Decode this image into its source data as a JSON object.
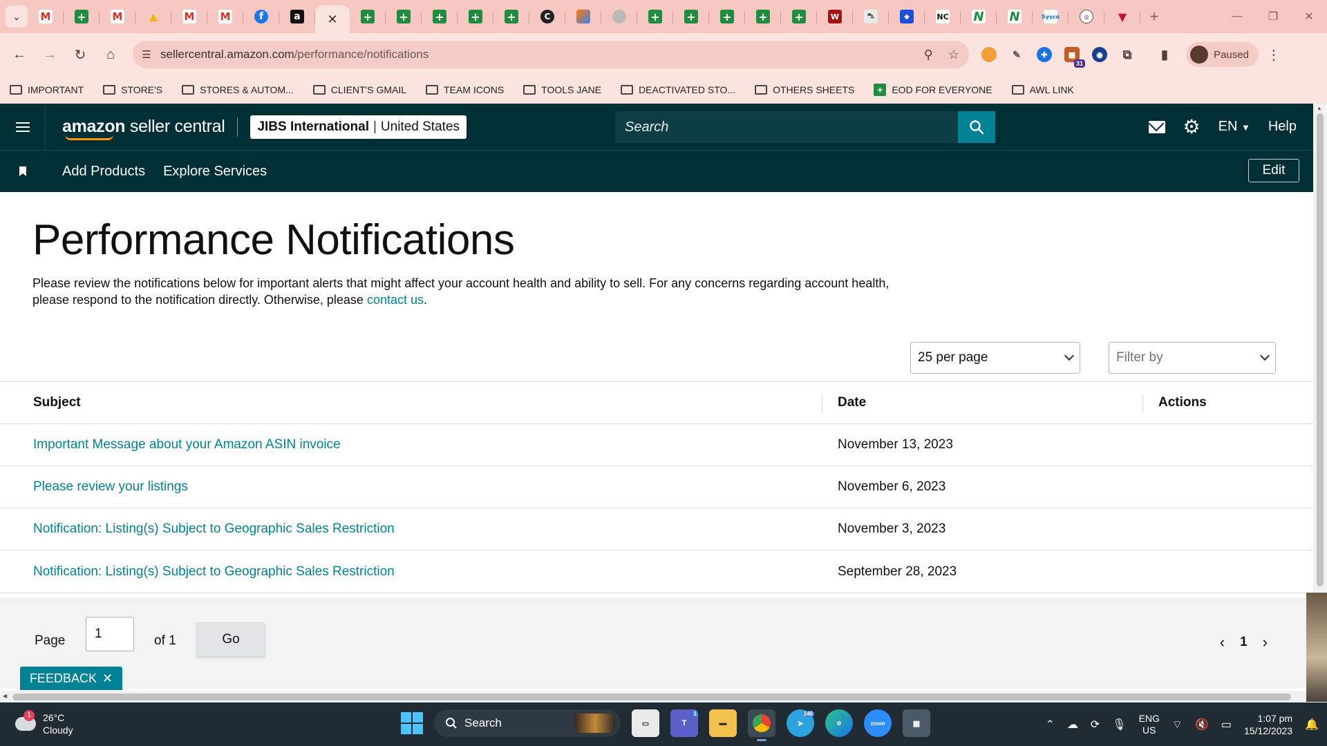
{
  "browser": {
    "url_host": "sellercentral.amazon.com",
    "url_path": "/performance/notifications",
    "profile_status": "Paused",
    "extension_badge": "31",
    "tabs": [
      {
        "icon": "gmail-icon",
        "glyph": "M",
        "style": "gmail"
      },
      {
        "icon": "sheets-icon",
        "glyph": "+",
        "style": "sheets"
      },
      {
        "icon": "gmail-icon",
        "glyph": "M",
        "style": "gmail"
      },
      {
        "icon": "drive-icon",
        "glyph": "▲",
        "style": "drive"
      },
      {
        "icon": "gmail-icon",
        "glyph": "M",
        "style": "gmail"
      },
      {
        "icon": "gmail-icon",
        "glyph": "M",
        "style": "gmail"
      },
      {
        "icon": "facebook-icon",
        "glyph": "f",
        "style": "fb"
      },
      {
        "icon": "amazon-icon",
        "glyph": "a",
        "style": "amz"
      }
    ],
    "tabs_after": [
      {
        "icon": "sheets-icon",
        "glyph": "+",
        "style": "sheets"
      },
      {
        "icon": "sheets-icon",
        "glyph": "+",
        "style": "sheets"
      },
      {
        "icon": "sheets-icon",
        "glyph": "+",
        "style": "sheets"
      },
      {
        "icon": "sheets-icon",
        "glyph": "+",
        "style": "sheets"
      },
      {
        "icon": "sheets-icon",
        "glyph": "+",
        "style": "sheets"
      },
      {
        "icon": "c-icon",
        "glyph": "C",
        "style": "dark"
      },
      {
        "icon": "multicolor-icon",
        "glyph": "",
        "style": "mix"
      },
      {
        "icon": "grey-circle-icon",
        "glyph": "",
        "style": "grey"
      },
      {
        "icon": "sheets-icon",
        "glyph": "+",
        "style": "sheets"
      },
      {
        "icon": "sheets-icon",
        "glyph": "+",
        "style": "sheets"
      },
      {
        "icon": "sheets-icon",
        "glyph": "+",
        "style": "sheets"
      },
      {
        "icon": "sheets-icon",
        "glyph": "+",
        "style": "sheets"
      },
      {
        "icon": "sheets-icon",
        "glyph": "+",
        "style": "sheets"
      },
      {
        "icon": "w-icon",
        "glyph": "W",
        "style": "red"
      },
      {
        "icon": "car-icon",
        "glyph": "⛍",
        "style": "car"
      },
      {
        "icon": "blue-logo-icon",
        "glyph": "◆",
        "style": "blue"
      },
      {
        "icon": "nc-icon",
        "glyph": "NC",
        "style": "nc"
      },
      {
        "icon": "n-icon",
        "glyph": "N",
        "style": "nn"
      },
      {
        "icon": "n-icon",
        "glyph": "N",
        "style": "nn"
      },
      {
        "icon": "sysco-icon",
        "glyph": "Sysco",
        "style": "sysco"
      },
      {
        "icon": "round-logo-icon",
        "glyph": "◎",
        "style": "round"
      },
      {
        "icon": "down-arrow-icon",
        "glyph": "▼",
        "style": "down"
      }
    ],
    "bookmarks": [
      {
        "label": "IMPORTANT",
        "type": "folder"
      },
      {
        "label": "STORE'S",
        "type": "folder"
      },
      {
        "label": "STORES & AUTOM...",
        "type": "folder"
      },
      {
        "label": "CLIENT'S GMAIL",
        "type": "folder"
      },
      {
        "label": "TEAM ICONS",
        "type": "folder"
      },
      {
        "label": "TOOLS JANE",
        "type": "folder"
      },
      {
        "label": "DEACTIVATED STO...",
        "type": "folder"
      },
      {
        "label": "OTHERS SHEETS",
        "type": "folder"
      },
      {
        "label": "EOD FOR EVERYONE",
        "type": "sheet"
      },
      {
        "label": "AWL LINK",
        "type": "folder"
      }
    ]
  },
  "header": {
    "logo_bold": "amazon",
    "logo_rest": " seller central",
    "account_name": "JIBS International",
    "account_region": "United States",
    "search_placeholder": "Search",
    "language": "EN",
    "help": "Help"
  },
  "subnav": {
    "items": [
      "Add Products",
      "Explore Services"
    ],
    "edit": "Edit"
  },
  "main": {
    "title": "Performance Notifications",
    "description": "Please review the notifications below for important alerts that might affect your account health and ability to sell. For any concerns regarding account health, please respond to the notification directly. Otherwise, please ",
    "contact_link": "contact us",
    "description_end": ".",
    "per_page": "25 per page",
    "filter_placeholder": "Filter by"
  },
  "table": {
    "headers": {
      "subject": "Subject",
      "date": "Date",
      "actions": "Actions"
    },
    "rows": [
      {
        "subject": "Important Message about your Amazon ASIN invoice",
        "date": "November 13, 2023"
      },
      {
        "subject": "Please review your listings",
        "date": "November 6, 2023"
      },
      {
        "subject": "Notification: Listing(s) Subject to Geographic Sales Restriction",
        "date": "November 3, 2023"
      },
      {
        "subject": "Notification: Listing(s) Subject to Geographic Sales Restriction",
        "date": "September 28, 2023"
      }
    ]
  },
  "pager": {
    "page_label": "Page",
    "page_value": "1",
    "of_label": "of 1",
    "go": "Go",
    "current": "1"
  },
  "feedback": "FEEDBACK",
  "taskbar": {
    "temperature": "26°C",
    "condition": "Cloudy",
    "weather_badge": "1",
    "search": "Search",
    "teams_badge": "1",
    "telegram_badge": "246",
    "zoom_label": "zoom",
    "lang_line1": "ENG",
    "lang_line2": "US",
    "time": "1:07 pm",
    "date": "15/12/2023"
  },
  "colors": {
    "amazon_header": "#002f36",
    "link": "#008296",
    "chrome_tab": "#f7c8c2",
    "chrome_toolbar": "#fbe3df",
    "orange": "#ff9900"
  }
}
